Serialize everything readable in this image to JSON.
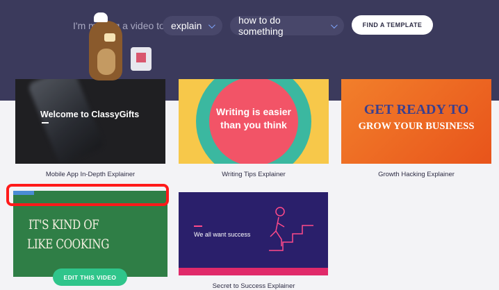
{
  "search": {
    "prefix": "I'm making a video to",
    "purpose_value": "explain",
    "topic_value": "how to do something",
    "find_button": "FIND A TEMPLATE"
  },
  "templates": [
    {
      "caption": "Mobile App In-Depth Explainer",
      "thumb_title": "Welcome to ClassyGifts"
    },
    {
      "caption": "Writing Tips Explainer",
      "thumb_line1": "Writing is easier",
      "thumb_line2": "than you think"
    },
    {
      "caption": "Growth Hacking Explainer",
      "thumb_line1": "GET READY TO",
      "thumb_line2": "GROW YOUR BUSINESS"
    },
    {
      "caption": "",
      "thumb_line1": "IT'S KIND OF",
      "thumb_line2": "LIKE COOKING",
      "edit_button": "EDIT THIS VIDEO"
    },
    {
      "caption": "Secret to Success Explainer",
      "thumb_title": "We all want success"
    }
  ],
  "colors": {
    "hero_bg": "#3b3a5c",
    "accent_green": "#2fc58b",
    "highlight_red": "#ff1a1a"
  }
}
